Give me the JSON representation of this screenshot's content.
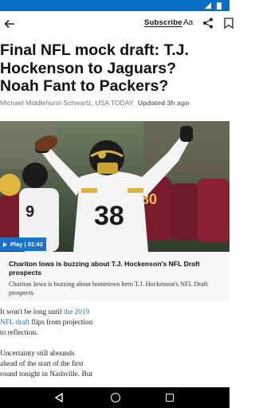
{
  "toolbar": {
    "subscribe_label": "Subscribe",
    "font_size_label": "Aa"
  },
  "article": {
    "headline_lines": [
      "Final NFL mock draft: T.J.",
      "Hockenson to Jaguars?",
      "Noah Fant to Packers?"
    ],
    "author": "Michael Middlehurst-Schwartz, USA TODAY",
    "updated": "Updated 3h ago",
    "jersey_number": "38",
    "video_badge": "Play | 01:42",
    "caption_title": "Chariton Iowa is buzzing about T.J. Hockenson's NFL Draft prospects",
    "caption_text": "Chariton Iowa is buzzing about hometown hero T.J. Hockenson's NFL Draft prospects",
    "p1_before": "It won't be long until ",
    "p1_link_line1": "the 2019",
    "p1_link_line2": "NFL draft",
    "p1_after_line2": " flips from projection",
    "p1_line3": "to reflection.",
    "p2_line1": "Uncertainty still abounds",
    "p2_line2": "ahead of the start of the first",
    "p2_line3": "round tonight in Nashville. But"
  },
  "colors": {
    "status_bar": "#0a6fc2",
    "accent_blue": "#1a73c8",
    "caption_bg": "#f6f6f6"
  },
  "icons": {
    "back": "arrow-left",
    "share": "share-nodes",
    "bookmark": "bookmark",
    "play": "triangle-right"
  }
}
